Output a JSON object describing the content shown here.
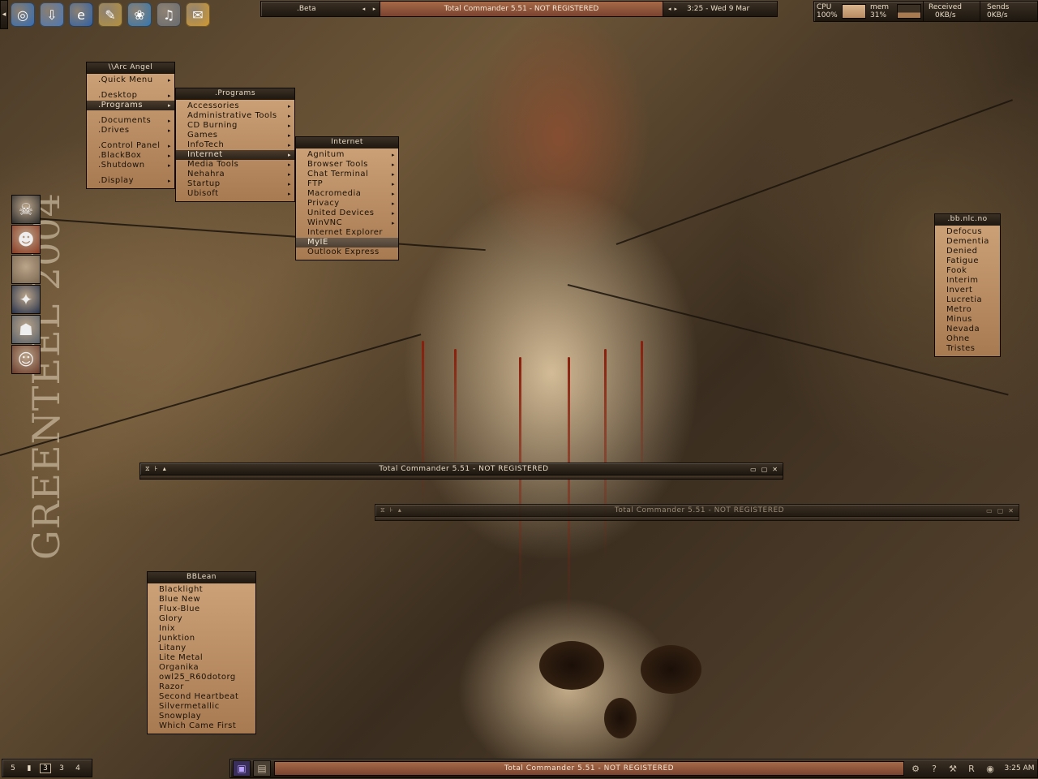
{
  "colors": {
    "accent_tan": "#c39a70",
    "title_dark": "#2a2118",
    "task_highlight": "#8f5238"
  },
  "wallpaper": {
    "signature": "GREENTEEL 2004"
  },
  "launcher": {
    "arrow": "◂",
    "buttons": [
      {
        "icon": "globe-icon",
        "glyph": "◎"
      },
      {
        "icon": "download-arrow-icon",
        "glyph": "⇩"
      },
      {
        "icon": "internet-explorer-icon",
        "glyph": "e"
      },
      {
        "icon": "tools-icon",
        "glyph": "✎"
      },
      {
        "icon": "flower-icon",
        "glyph": "❀"
      },
      {
        "icon": "headphones-icon",
        "glyph": "♫"
      },
      {
        "icon": "mail-icon",
        "glyph": "✉"
      }
    ]
  },
  "topbar": {
    "workspace": ".Beta",
    "left_arrow": "◂",
    "right_arrow": "▸",
    "window_title": "Total Commander 5.51 - NOT REGISTERED",
    "clock": "3:25 - Wed 9 Mar"
  },
  "monitor": {
    "cpu_label": "CPU",
    "cpu_value": "100%",
    "mem_label": "mem",
    "mem_value": "31%",
    "recv_label": "Received",
    "recv_value": "0KB/s",
    "send_label": "Sends",
    "send_value": "0KB/s"
  },
  "root_menu": {
    "title": "\\\\Arc Angel",
    "items": [
      {
        "label": ".Quick Menu",
        "sub": "▸"
      },
      {
        "label": ".Desktop",
        "sub": "▸"
      },
      {
        "label": ".Programs",
        "sub": "▸"
      },
      {
        "label": ".Documents",
        "sub": "▸"
      },
      {
        "label": ".Drives",
        "sub": "▸"
      },
      {
        "label": ".Control Panel",
        "sub": "▸"
      },
      {
        "label": ".BlackBox",
        "sub": "▸"
      },
      {
        "label": ".Shutdown",
        "sub": "▸"
      },
      {
        "label": ".Display",
        "sub": "▸"
      }
    ]
  },
  "programs_menu": {
    "title": ".Programs",
    "items": [
      {
        "label": "Accessories",
        "sub": "▸"
      },
      {
        "label": "Administrative Tools",
        "sub": "▸"
      },
      {
        "label": "CD Burning",
        "sub": "▸"
      },
      {
        "label": "Games",
        "sub": "▸"
      },
      {
        "label": "InfoTech",
        "sub": "▸"
      },
      {
        "label": "Internet",
        "sub": "▸"
      },
      {
        "label": "Media Tools",
        "sub": "▸"
      },
      {
        "label": "Nehahra",
        "sub": "▸"
      },
      {
        "label": "Startup",
        "sub": "▸"
      },
      {
        "label": "Ubisoft",
        "sub": "▸"
      }
    ]
  },
  "internet_menu": {
    "title": "Internet",
    "items": [
      {
        "label": "Agnitum",
        "sub": "▸"
      },
      {
        "label": "Browser Tools",
        "sub": "▸"
      },
      {
        "label": "Chat Terminal",
        "sub": "▸"
      },
      {
        "label": "FTP",
        "sub": "▸"
      },
      {
        "label": "Macromedia",
        "sub": "▸"
      },
      {
        "label": "Privacy",
        "sub": "▸"
      },
      {
        "label": "United Devices",
        "sub": "▸"
      },
      {
        "label": "WinVNC",
        "sub": "▸"
      },
      {
        "label": "Internet Explorer",
        "sub": ""
      },
      {
        "label": "MyIE",
        "sub": ""
      },
      {
        "label": "Outlook Express",
        "sub": ""
      }
    ]
  },
  "styles_menu": {
    "title": ".bb.nlc.no",
    "items": [
      "Defocus",
      "Dementia",
      "Denied",
      "Fatigue",
      "Fook",
      "Interim",
      "Invert",
      "Lucretia",
      "Metro",
      "Minus",
      "Nevada",
      "Ohne",
      "Tristes"
    ]
  },
  "bblean_menu": {
    "title": "BBLean",
    "items": [
      "Blacklight",
      "Blue New",
      "Flux-Blue",
      "Glory",
      "Inix",
      "Junktion",
      "Litany",
      "Lite Metal",
      "Organika",
      "owl25_R60dotorg",
      "Razor",
      "Second Heartbeat",
      "Silvermetallic",
      "Snowplay",
      "Which Came First"
    ]
  },
  "dock": {
    "icons": [
      "skull-icon",
      "demon-face-icon",
      "blank-slot-icon",
      "winged-emblem-icon",
      "robot-head-icon",
      "portrait-icon"
    ]
  },
  "window1": {
    "title": "Total Commander 5.51 - NOT REGISTERED",
    "left_glyphs": [
      "⧖",
      "⊦",
      "▴"
    ],
    "right_glyphs": [
      "▭",
      "▢",
      "✕"
    ]
  },
  "window2": {
    "title": "Total Commander 5.51 - NOT REGISTERED",
    "left_glyphs": [
      "⧖",
      "⊦",
      "▴"
    ],
    "right_glyphs": [
      "▭",
      "▢",
      "✕"
    ]
  },
  "bottom": {
    "workspaces": [
      "5",
      "▮",
      "3",
      "3",
      "4"
    ],
    "task_title": "Total Commander 5.51 - NOT REGISTERED",
    "time": "3:25 AM",
    "task_icons": [
      {
        "icon": "floppy-icon",
        "glyph": "▣"
      },
      {
        "icon": "save-icon",
        "glyph": "▤"
      }
    ],
    "tray_icons": [
      {
        "icon": "gear-icon",
        "glyph": "⚙"
      },
      {
        "icon": "help-icon",
        "glyph": "?"
      },
      {
        "icon": "wrench-icon",
        "glyph": "⚒"
      },
      {
        "icon": "r-logo-icon",
        "glyph": "R"
      },
      {
        "icon": "disc-icon",
        "glyph": "◉"
      }
    ]
  }
}
